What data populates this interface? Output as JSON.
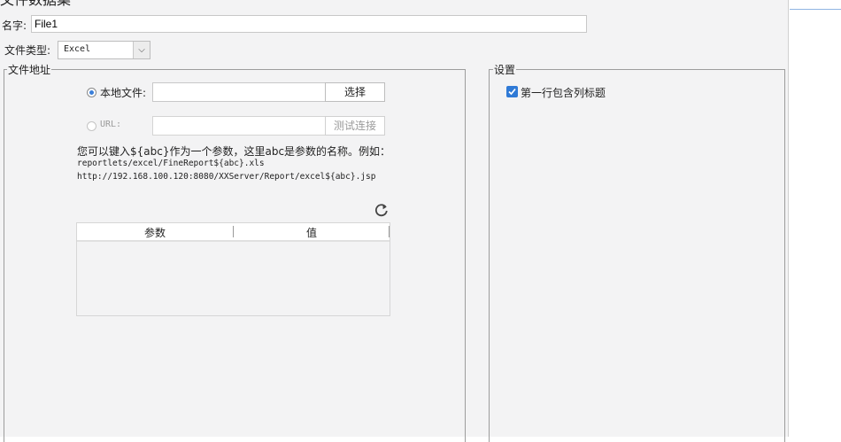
{
  "window": {
    "title": "文件数据集",
    "close_glyph": "✕"
  },
  "form": {
    "name_label": "名字:",
    "name_value": "File1",
    "filetype_label": "文件类型:",
    "filetype_value": "Excel"
  },
  "file_address": {
    "group_title": "文件地址",
    "local_label": "本地文件:",
    "local_value": "",
    "choose_button": "选择",
    "url_label": "URL:",
    "url_value": "",
    "test_button": "测试连接",
    "hint_line1": "您可以键入${abc}作为一个参数，这里abc是参数的名称。例如：",
    "hint_line2": "reportlets/excel/FineReport${abc}.xls",
    "hint_line3": "http://192.168.100.120:8080/XXServer/Report/excel${abc}.jsp",
    "refresh_icon": "refresh-icon",
    "table": {
      "columns": [
        "参数",
        "值"
      ],
      "rows": []
    }
  },
  "settings": {
    "group_title": "设置",
    "first_row_header_label": "第一行包含列标题",
    "first_row_header_checked": true
  },
  "colors": {
    "accent": "#2f7ad6",
    "dialog_bg": "#f3f3f4"
  }
}
